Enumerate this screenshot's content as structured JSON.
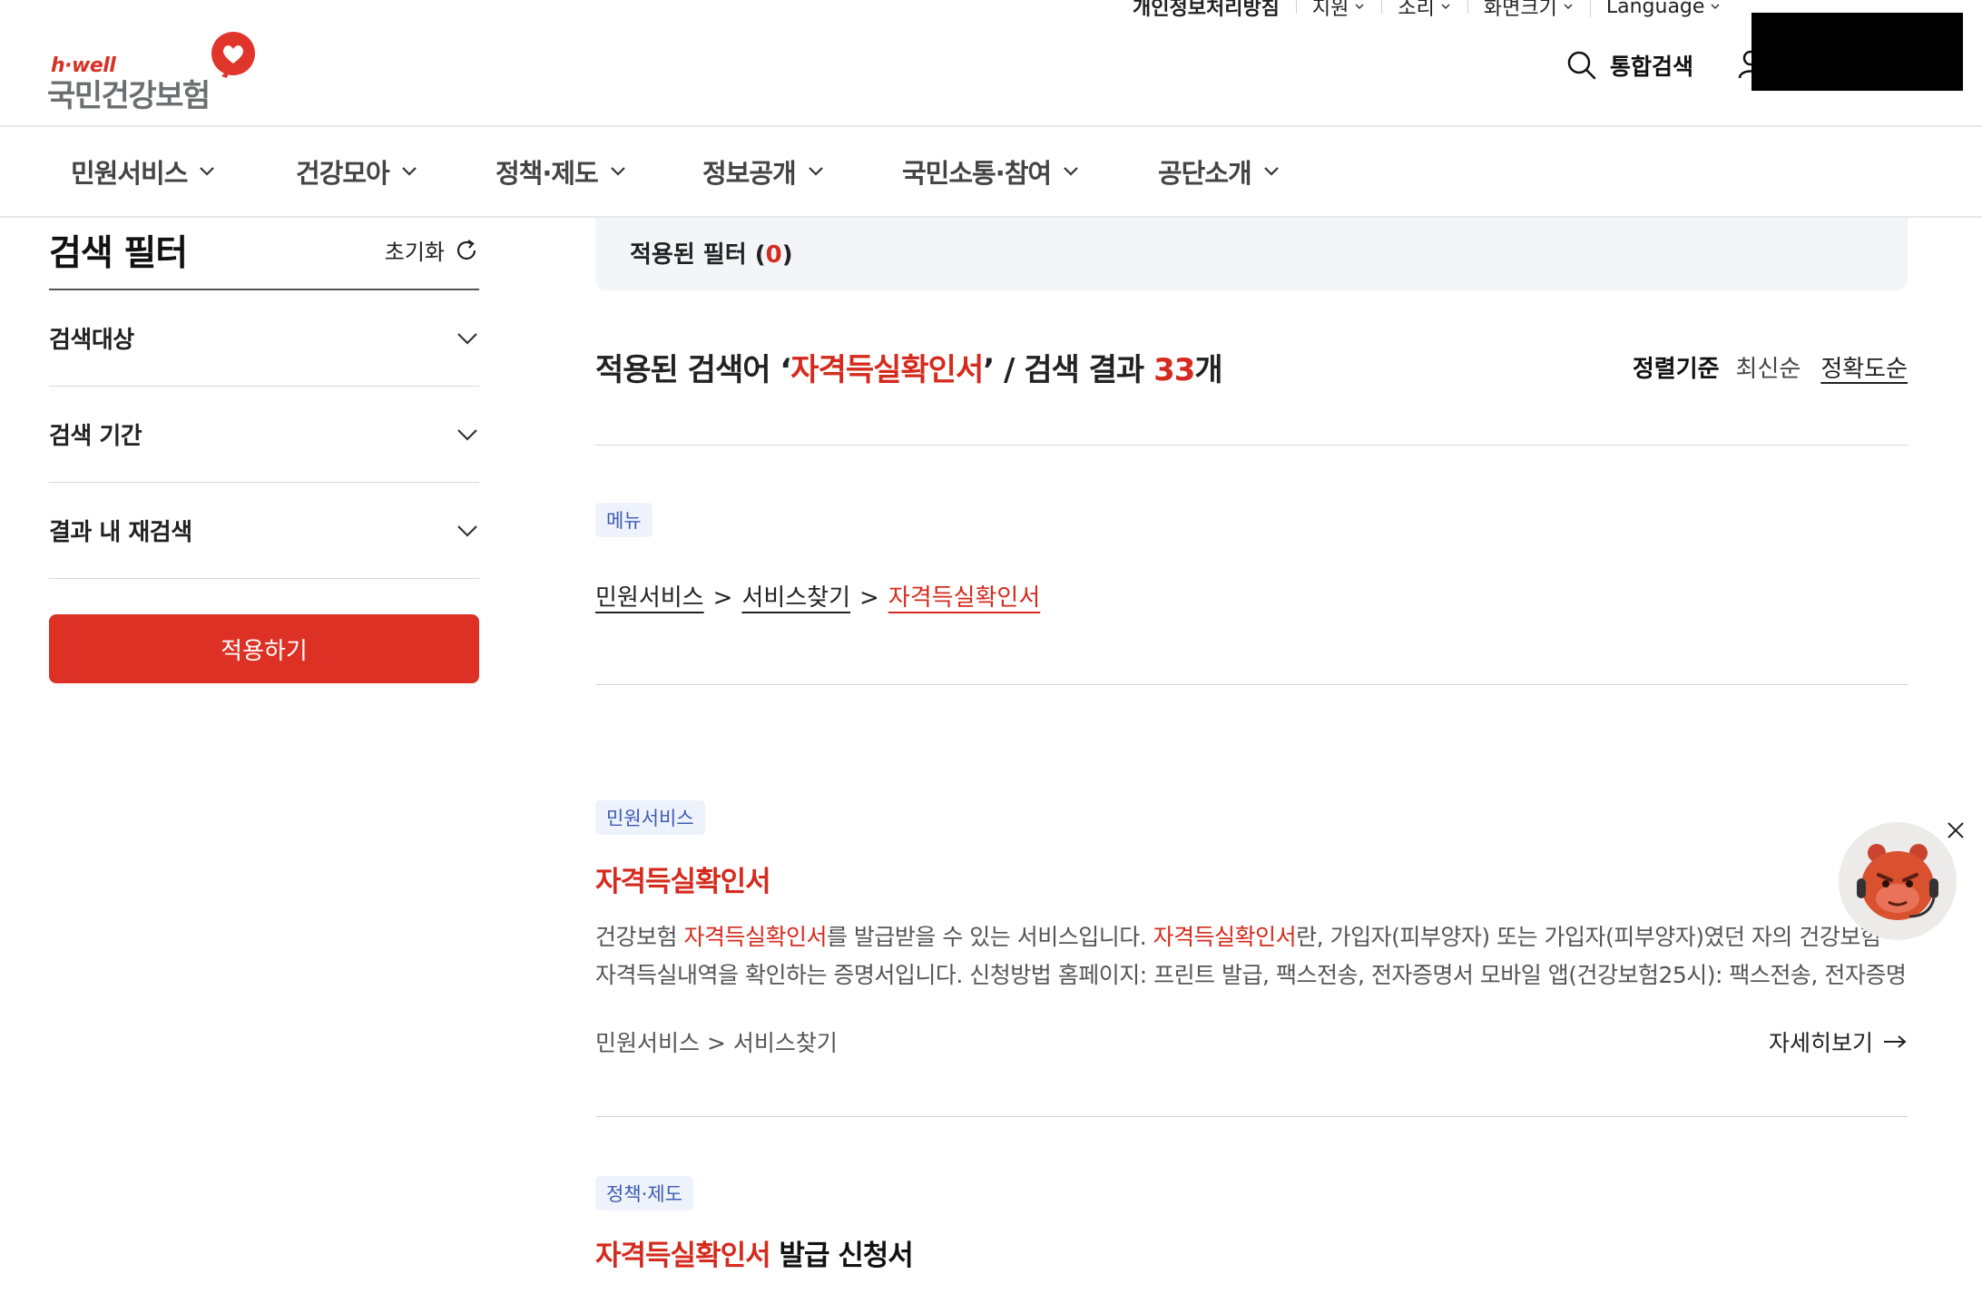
{
  "header": {
    "logo_small": "h·well",
    "logo_main": "국민건강보험",
    "utility": [
      {
        "label": "개인정보처리방침",
        "has_chevron": false
      },
      {
        "label": "지원",
        "has_chevron": true
      },
      {
        "label": "소리",
        "has_chevron": true
      },
      {
        "label": "화면크기",
        "has_chevron": true
      },
      {
        "label": "Language",
        "has_chevron": true
      }
    ],
    "search_label": "통합검색"
  },
  "gnb": {
    "items": [
      "민원서비스",
      "건강모아",
      "정책·제도",
      "정보공개",
      "국민소통·참여",
      "공단소개"
    ]
  },
  "filter": {
    "title": "검색 필터",
    "reset_label": "초기화",
    "sections": [
      "검색대상",
      "검색 기간",
      "결과 내 재검색"
    ],
    "apply_label": "적용하기"
  },
  "applied": {
    "label_prefix": "적용된 필터 (",
    "count": "0",
    "label_suffix": ")"
  },
  "summary": {
    "prefix": "적용된 검색어 ‘",
    "term": "자격득실확인서",
    "middle": "’ / 검색 결과 ",
    "count": "33",
    "suffix": "개"
  },
  "sort": {
    "label": "정렬기준",
    "options": [
      "최신순",
      "정확도순"
    ],
    "active": "정확도순"
  },
  "menu_result": {
    "badge": "메뉴",
    "path": [
      "민원서비스",
      "서비스찾기",
      "자격득실확인서"
    ],
    "separator": ">"
  },
  "results": [
    {
      "badge": "민원서비스",
      "title_highlight": "자격득실확인서",
      "title_rest": "",
      "desc": [
        {
          "t": "건강보험 ",
          "hl": false
        },
        {
          "t": "자격득실확인서",
          "hl": true
        },
        {
          "t": "를 발급받을 수 있는 서비스입니다. ",
          "hl": false
        },
        {
          "t": "자격득실확인서",
          "hl": true
        },
        {
          "t": "란, 가입자(피부양자) 또는 가입자(피부양자)였던 자의 건강보험 자격득실내역을 확인하는 증명서입니다. 신청방법 홈페이지: 프린트 발급, 팩스전송, 전자증명서 모바일 앱(건강보험25시): 팩스전송, 전자증명서 방문: 전국 지사",
          "hl": false
        }
      ],
      "path": "민원서비스 > 서비스찾기",
      "more_label": "자세히보기"
    },
    {
      "badge": "정책·제도",
      "title_highlight": "자격득실확인서",
      "title_rest": " 발급 신청서"
    }
  ],
  "colors": {
    "accent": "#d52b1e",
    "apply_button": "#dd3125",
    "badge_bg": "#eef2fb",
    "badge_text": "#3c5bb3",
    "applied_bg": "#f4f5f9"
  }
}
